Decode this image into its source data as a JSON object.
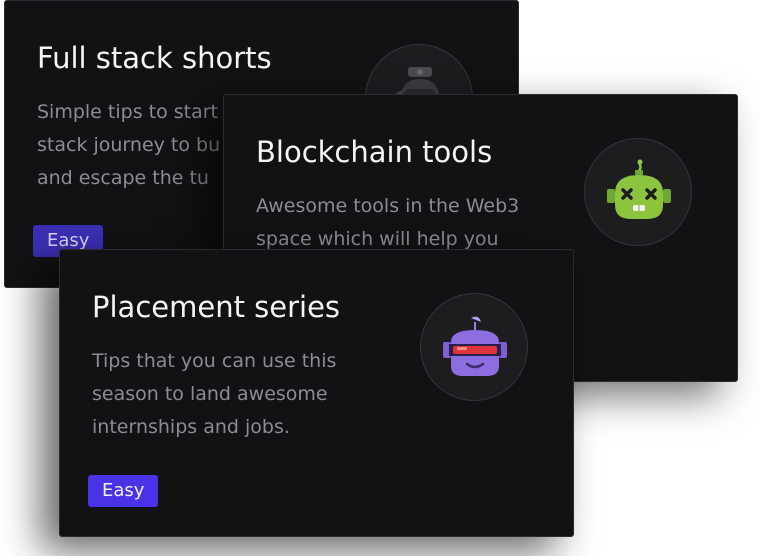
{
  "cards": [
    {
      "title": "Full stack shorts",
      "description_lines": [
        "Simple tips to start",
        "stack journey to bu",
        "and escape the tu"
      ],
      "badge": "Easy",
      "avatar_icon": "robot-helmet-icon"
    },
    {
      "title": "Blockchain tools",
      "description_lines": [
        "Awesome tools in the Web3",
        "space which will help you"
      ],
      "avatar_icon": "green-robot-icon"
    },
    {
      "title": "Placement series",
      "description_lines": [
        "Tips that you can use this",
        "season to land awesome",
        "internships and jobs."
      ],
      "badge": "Easy",
      "avatar_icon": "purple-robot-visor-icon"
    }
  ],
  "colors": {
    "card_background": "#121214",
    "badge_accent": "#4a32e6",
    "title_text": "#f4f4f6",
    "description_text": "#8c8c93"
  }
}
